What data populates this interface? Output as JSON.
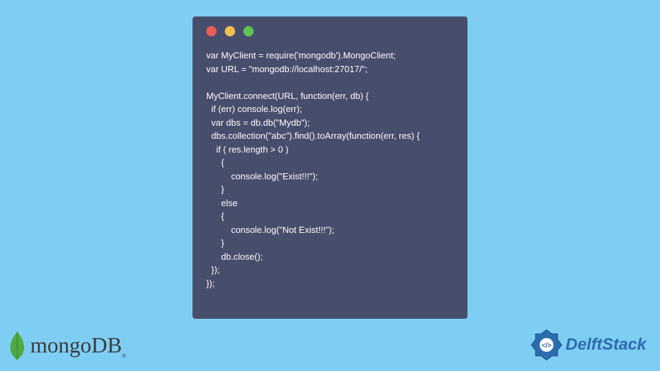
{
  "code": {
    "line1": "var MyClient = require('mongodb').MongoClient;",
    "line2": "var URL = \"mongodb://localhost:27017/\";",
    "line3": "",
    "line4": "MyClient.connect(URL, function(err, db) {",
    "line5": "  if (err) console.log(err);",
    "line6": "  var dbs = db.db(\"Mydb\");",
    "line7": "  dbs.collection(\"abc\").find().toArray(function(err, res) {",
    "line8": "    if ( res.length > 0 )",
    "line9": "      {",
    "line10": "          console.log(\"Exist!!!\");",
    "line11": "      }",
    "line12": "      else",
    "line13": "      {",
    "line14": "          console.log(\"Not Exist!!!\");",
    "line15": "      }",
    "line16": "      db.close();",
    "line17": "  });",
    "line18": "});"
  },
  "logos": {
    "mongo": "mongoDB",
    "mongo_sub": "®",
    "delft": "DelftStack"
  }
}
